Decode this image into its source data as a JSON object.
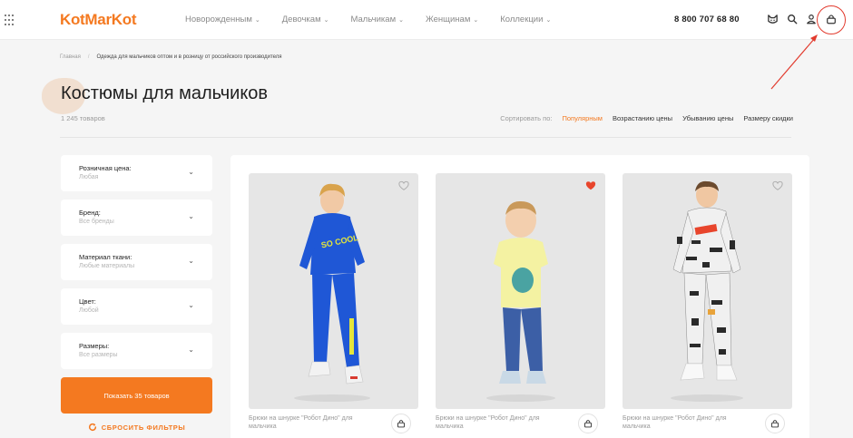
{
  "header": {
    "logo": "KotMarKot",
    "nav": [
      {
        "label": "Новорожденным",
        "icon": "chevron-down-icon"
      },
      {
        "label": "Девочкам",
        "icon": "chevron-down-icon"
      },
      {
        "label": "Мальчикам",
        "icon": "chevron-down-icon"
      },
      {
        "label": "Женщинам",
        "icon": "chevron-down-icon"
      },
      {
        "label": "Коллекции",
        "icon": "chevron-down-icon"
      }
    ],
    "chevron": "⌄",
    "phone": "8 800 707 68 80",
    "icons": [
      "cat-icon",
      "search-icon",
      "user-icon",
      "cart-icon"
    ],
    "highlight_color": "#e23b2e"
  },
  "breadcrumb": {
    "home": "Главная",
    "separator": "/",
    "current": "Одежда для мальчиков оптом и в розницу от российского производителя"
  },
  "page": {
    "title": "Костюмы для мальчиков",
    "count": "1 245 товаров"
  },
  "sort": {
    "label": "Сортировать по:",
    "options": [
      "Популярным",
      "Возрастанию цены",
      "Убыванию цены",
      "Размеру скидки"
    ],
    "active_index": 0
  },
  "filters": [
    {
      "title": "Розничная цена:",
      "value": "Любая"
    },
    {
      "title": "Бренд:",
      "value": "Все бренды"
    },
    {
      "title": "Материал ткани:",
      "value": "Любые материалы"
    },
    {
      "title": "Цвет:",
      "value": "Любой"
    },
    {
      "title": "Размеры:",
      "value": "Все размеры"
    }
  ],
  "filter_chevron": "⌄",
  "show_button": "Показать 35 товаров",
  "reset_button": "СБРОСИТЬ ФИЛЬТРЫ",
  "products": [
    {
      "name": "Брюки на шнурке \"Робот Дино\" для мальчика",
      "favorite": false,
      "outfit": "blue-tracksuit"
    },
    {
      "name": "Брюки на шнурке \"Робот Дино\" для мальчика",
      "favorite": true,
      "outfit": "yellow-tee-jeans"
    },
    {
      "name": "Брюки на шнурке \"Робот Дино\" для мальчика",
      "favorite": false,
      "outfit": "graffiti-print-suit"
    }
  ],
  "colors": {
    "accent": "#f47920",
    "heart_active": "#e8452c"
  }
}
